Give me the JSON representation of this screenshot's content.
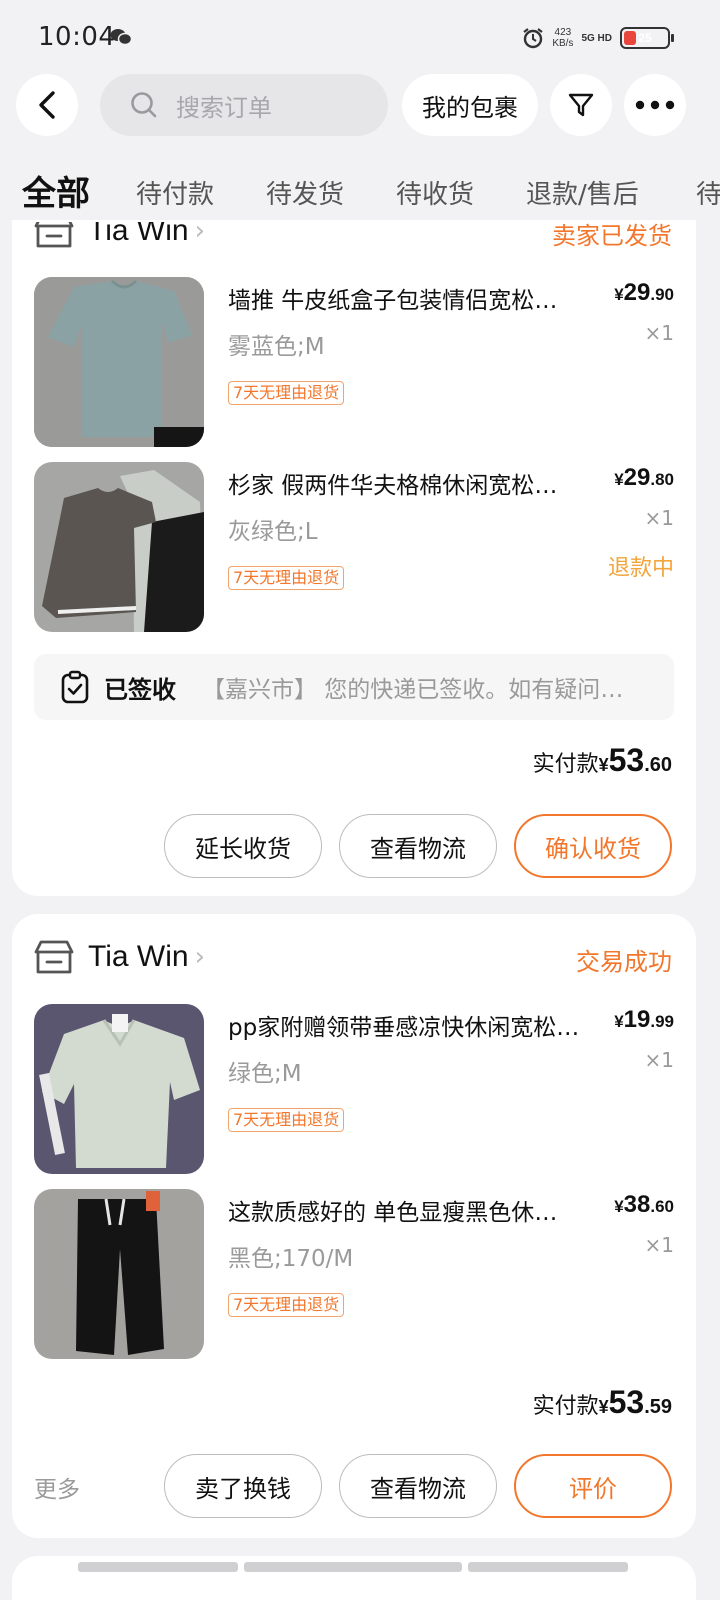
{
  "status_bar": {
    "time": "10:04",
    "speed_value": "423",
    "speed_unit": "KB/s",
    "network": "5G HD",
    "battery": "25"
  },
  "top_bar": {
    "search_placeholder": "搜索订单",
    "packages_label": "我的包裹"
  },
  "tabs": [
    {
      "label": "全部",
      "active": true
    },
    {
      "label": "待付款",
      "active": false
    },
    {
      "label": "待发货",
      "active": false
    },
    {
      "label": "待收货",
      "active": false
    },
    {
      "label": "退款/售后",
      "active": false
    },
    {
      "label": "待",
      "active": false
    }
  ],
  "orders": [
    {
      "shop_name": "Tia Win",
      "status": "卖家已发货",
      "items": [
        {
          "title": "墙推 牛皮纸盒子包装情侣宽松短袖T恤",
          "spec": "雾蓝色;M",
          "tag": "7天无理由退货",
          "price_currency": "¥",
          "price_int": "29",
          "price_dec": ".90",
          "qty": "×1",
          "refund": ""
        },
        {
          "title": "杉家 假两件华夫格棉休闲宽松长袖T恤",
          "spec": "灰绿色;L",
          "tag": "7天无理由退货",
          "price_currency": "¥",
          "price_int": "29",
          "price_dec": ".80",
          "qty": "×1",
          "refund": "退款中"
        }
      ],
      "logistics": {
        "status": "已签收",
        "text": "【嘉兴市】 您的快递已签收。如有疑问请联系快递员"
      },
      "paid_label": "实付款",
      "paid_currency": "¥",
      "paid_int": "53",
      "paid_dec": ".60",
      "buttons": [
        "延长收货",
        "查看物流",
        "确认收货"
      ]
    },
    {
      "shop_name": "Tia Win",
      "status": "交易成功",
      "items": [
        {
          "title": "pp家附赠领带垂感凉快休闲宽松短袖衬衫",
          "spec": "绿色;M",
          "tag": "7天无理由退货",
          "price_currency": "¥",
          "price_int": "19",
          "price_dec": ".99",
          "qty": "×1",
          "refund": ""
        },
        {
          "title": "这款质感好的 单色显瘦黑色休闲长裤",
          "spec": "黑色;170/M",
          "tag": "7天无理由退货",
          "price_currency": "¥",
          "price_int": "38",
          "price_dec": ".60",
          "qty": "×1",
          "refund": ""
        }
      ],
      "paid_label": "实付款",
      "paid_currency": "¥",
      "paid_int": "53",
      "paid_dec": ".59",
      "more_label": "更多",
      "buttons": [
        "卖了换钱",
        "查看物流",
        "评价"
      ]
    }
  ],
  "colors": {
    "accent": "#f2772c",
    "refund": "#f2a53c",
    "page_bg": "#f2f2f4"
  },
  "icons": [
    "back-icon",
    "search-icon",
    "filter-icon",
    "more-dots-icon",
    "shop-icon",
    "chevron-right-icon",
    "signed-clipboard-icon",
    "wechat-icon",
    "alarm-icon",
    "battery-icon"
  ]
}
